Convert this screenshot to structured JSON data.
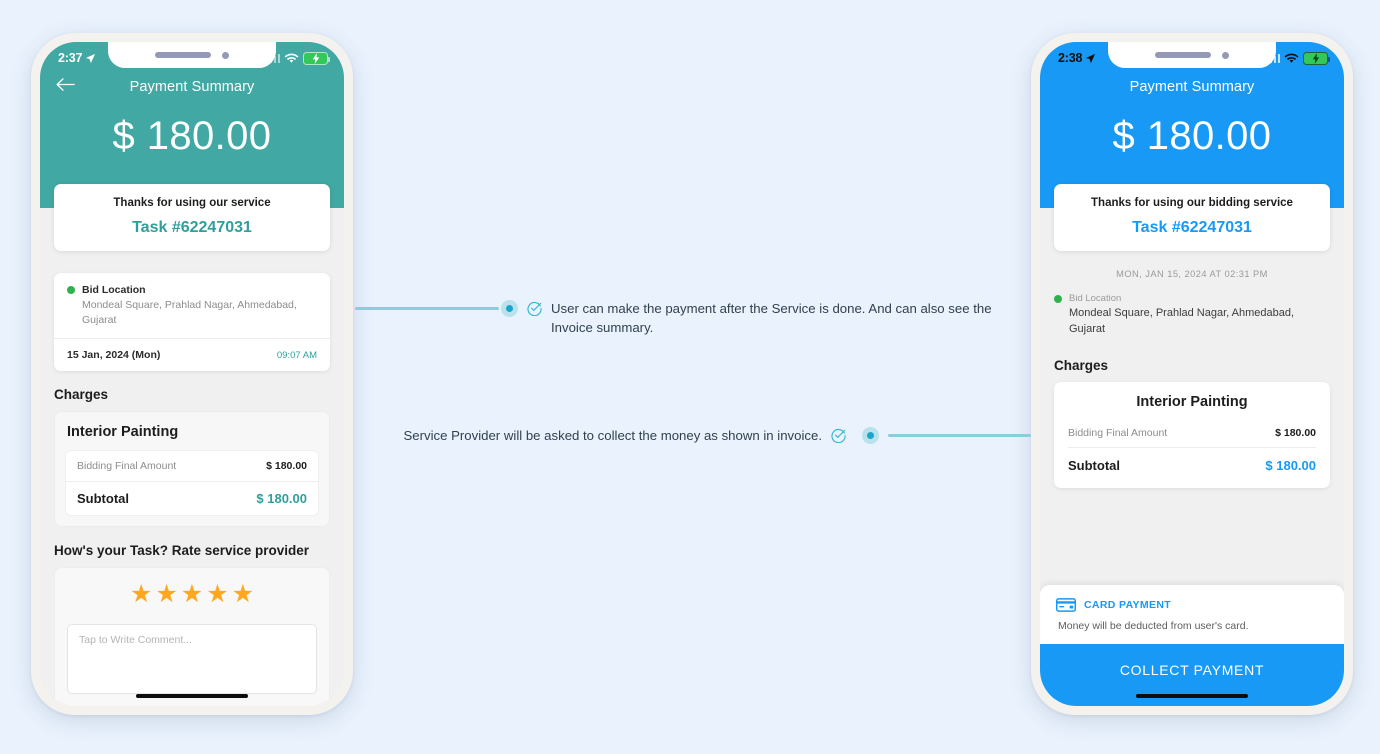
{
  "page": {
    "background": "#e9f2fd"
  },
  "theme": {
    "teal": "#41a8a3",
    "blue": "#1799f5",
    "connector": "#86cfdd",
    "dot_outer": "#b9e2ec",
    "dot_inner": "#1aa6c9",
    "star": "#ffa81f",
    "green": "#2fb24c"
  },
  "left_phone": {
    "status": {
      "time": "2:37",
      "location_icon": "location-arrow-icon",
      "signal_icon": "cellular-signal-icon",
      "wifi_icon": "wifi-icon",
      "battery_icon": "battery-charging-icon",
      "text_color": "#ffffff"
    },
    "header": {
      "back_icon": "back-arrow-icon",
      "title": "Payment Summary",
      "amount": "$ 180.00"
    },
    "thanks": {
      "title": "Thanks for using our service",
      "task": "Task #62247031"
    },
    "location": {
      "label": "Bid Location",
      "address": "Mondeal Square, Prahlad Nagar, Ahmedabad, Gujarat",
      "date": "15 Jan, 2024 (Mon)",
      "time": "09:07 AM"
    },
    "charges": {
      "section_title": "Charges",
      "service_name": "Interior Painting",
      "rows": [
        {
          "label": "Bidding Final Amount",
          "value": "$ 180.00"
        }
      ],
      "total_label": "Subtotal",
      "total_value": "$ 180.00"
    },
    "rating": {
      "prompt": "How's your Task? Rate service provider",
      "stars": "★★★★★",
      "star_count": 5,
      "comment_placeholder": "Tap to Write Comment..."
    }
  },
  "right_phone": {
    "status": {
      "time": "2:38",
      "location_icon": "location-arrow-icon",
      "signal_icon": "cellular-signal-icon",
      "wifi_icon": "wifi-icon",
      "battery_icon": "battery-charging-icon",
      "text_color": "#101010"
    },
    "header": {
      "title": "Payment Summary",
      "amount": "$ 180.00"
    },
    "thanks": {
      "title": "Thanks for using our bidding service",
      "task": "Task #62247031"
    },
    "timestamp": "MON, JAN 15, 2024 AT 02:31 PM",
    "location": {
      "label": "Bid Location",
      "address": "Mondeal Square, Prahlad Nagar, Ahmedabad, Gujarat"
    },
    "charges": {
      "section_title": "Charges",
      "service_name": "Interior Painting",
      "rows": [
        {
          "label": "Bidding Final Amount",
          "value": "$ 180.00"
        }
      ],
      "total_label": "Subtotal",
      "total_value": "$ 180.00"
    },
    "payment": {
      "card_icon": "credit-card-icon",
      "method_label": "CARD PAYMENT",
      "note": "Money will be deducted from user's card.",
      "cta": "COLLECT PAYMENT"
    }
  },
  "callouts": [
    {
      "icon": "check-circle-icon",
      "text": "User can make the payment after the Service is done. And can also see the Invoice summary."
    },
    {
      "icon": "check-circle-icon",
      "text": "Service Provider will be asked to collect the money as shown in invoice."
    }
  ]
}
